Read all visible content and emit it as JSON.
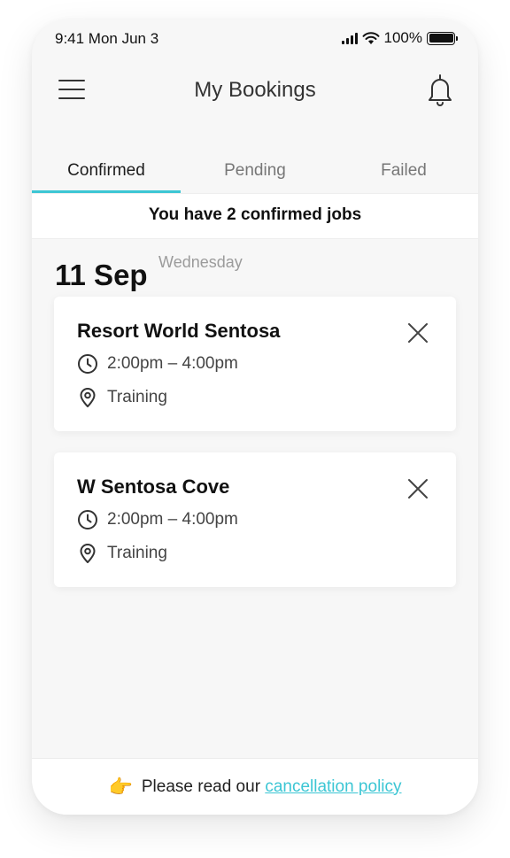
{
  "status_bar": {
    "time": "9:41  Mon Jun 3",
    "battery": "100%"
  },
  "header": {
    "title": "My Bookings"
  },
  "tabs": [
    {
      "label": "Confirmed",
      "active": true
    },
    {
      "label": "Pending",
      "active": false
    },
    {
      "label": "Failed",
      "active": false
    }
  ],
  "summary": "You have 2 confirmed jobs",
  "date_group": {
    "date": "11 Sep",
    "weekday": "Wednesday"
  },
  "bookings": [
    {
      "title": "Resort World Sentosa",
      "time": "2:00pm – 4:00pm",
      "category": "Training"
    },
    {
      "title": "W Sentosa Cove",
      "time": "2:00pm – 4:00pm",
      "category": "Training"
    }
  ],
  "footer": {
    "emoji": "👉",
    "text": "Please read our",
    "link": "cancellation policy"
  },
  "colors": {
    "accent": "#3cc6d4",
    "background": "#f7f7f7"
  },
  "icons": [
    "menu-icon",
    "bell-icon",
    "close-icon",
    "clock-icon",
    "location-pin-icon"
  ]
}
